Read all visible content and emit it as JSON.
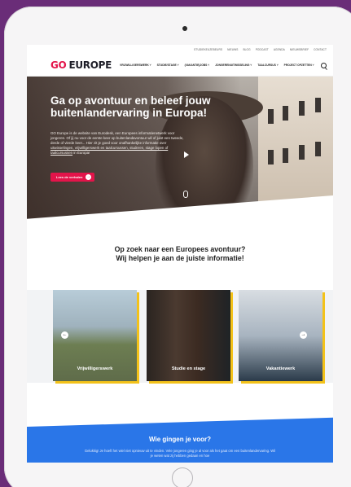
{
  "topbar": {
    "links": [
      "STUDIEKEUZEBEURS",
      "NIEUWS",
      "BLOG",
      "PODCAST",
      "AGENDA",
      "NIEUWSBRIEF",
      "CONTACT"
    ]
  },
  "nav": {
    "logo_go": "GO",
    "logo_europe": "EUROPE",
    "menu": [
      "VRIJWILLIGERSWERK ˅",
      "STUDIE/STAGE ˅",
      "(VAKANTIE)JOBS ˅",
      "JONGERENUITWISSELING ˅",
      "TAALCURSUS ˅",
      "PROJECT OPZETTEN ˅"
    ]
  },
  "hero": {
    "title": "Ga op avontuur en beleef jouw buitenlandervaring in Europa!",
    "body_1": "GO Europe is de website van Eurodesk, een Europees informatienetwerk voor jongeren. Of jij nu voor de eerste keer op buitenlandavontuur wil of juist een tweede, derde of vierde keer... Hier zit je goed voor onafhankelijke informatie over",
    "body_link_1": "uitwisselingen, vrijwilligerswerk en taalcursussen, studeren, stage lopen of taalcursussen",
    "body_2": " in Europa!",
    "button_label": "Lees de verhalen",
    "button_arrow": "→"
  },
  "intro": {
    "line_1": "Op zoek naar een Europees avontuur?",
    "line_2": "Wij helpen je aan de juiste informatie!"
  },
  "cards": [
    {
      "label": "Vrijwilligerswerk"
    },
    {
      "label": "Studie en stage"
    },
    {
      "label": "Vakantiewerk"
    }
  ],
  "carousel": {
    "prev": "←",
    "next": "→"
  },
  "section": {
    "title": "Wie gingen je voor?",
    "body": "Gelukkig! Je hoeft het wiel niet opnieuw uit te vinden. Vele jongeren ging je al voor als het gaat om een buitenlandervaring. Wil je weten wat zij hebben gedaan en hoe"
  }
}
